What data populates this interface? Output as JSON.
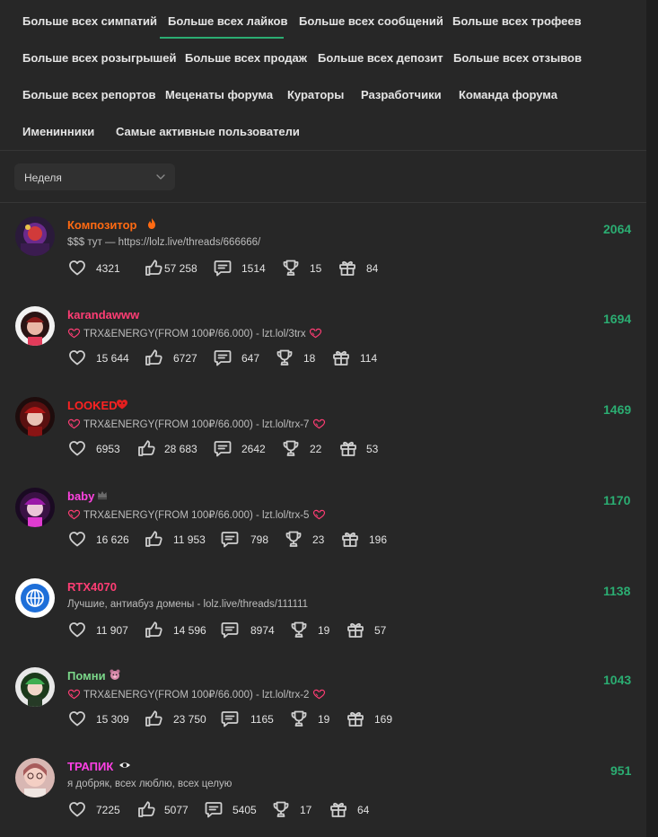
{
  "tabs": [
    "Больше всех симпатий",
    "Больше всех лайков",
    "Больше всех сообщений",
    "Больше всех трофеев",
    "Больше всех розыгрышей",
    "Больше всех продаж",
    "Больше всех депозит",
    "Больше всех отзывов",
    "Больше всех репортов",
    "Меценаты форума",
    "Кураторы",
    "Разработчики",
    "Команда форума",
    "Именинники",
    "Самые активные пользователи"
  ],
  "active_tab": "Больше всех лайков",
  "period": {
    "selected": "Неделя"
  },
  "users": [
    {
      "name": "Композитор",
      "name_color": "#ff6a12",
      "status": "$$$ тут — https://lolz.live/threads/666666/",
      "score": "2064",
      "likes": "4321",
      "thumbs": "57 258",
      "messages": "1514",
      "trophies": "15",
      "gifts": "84",
      "badge": "fire-icon"
    },
    {
      "name": "karandawww",
      "name_color": "#ff3d74",
      "status": "TRX&ENERGY(FROM 100₽/66.000) - lzt.lol/3trx",
      "score": "1694",
      "likes": "15 644",
      "thumbs": "6727",
      "messages": "647",
      "trophies": "18",
      "gifts": "114"
    },
    {
      "name": "LOOKED",
      "name_color": "#ff2222",
      "status": "TRX&ENERGY(FROM 100₽/66.000) - lzt.lol/trx-7",
      "score": "1469",
      "likes": "6953",
      "thumbs": "28 683",
      "messages": "2642",
      "trophies": "22",
      "gifts": "53",
      "badge": "heart-face-icon"
    },
    {
      "name": "baby",
      "name_color": "#ff43e0",
      "status": "TRX&ENERGY(FROM 100₽/66.000) - lzt.lol/trx-5",
      "score": "1170",
      "likes": "16 626",
      "thumbs": "11 953",
      "messages": "798",
      "trophies": "23",
      "gifts": "196",
      "badge": "crown-icon"
    },
    {
      "name": "RTX4070",
      "name_color": "#ff3d74",
      "status": "Лучшие, антиабуз домены - lolz.live/threads/111111",
      "score": "1138",
      "likes": "11 907",
      "thumbs": "14 596",
      "messages": "8974",
      "trophies": "19",
      "gifts": "57"
    },
    {
      "name": "Помни",
      "name_color": "#7bd88a",
      "status": "TRX&ENERGY(FROM 100₽/66.000) - lzt.lol/trx-2",
      "score": "1043",
      "likes": "15 309",
      "thumbs": "23 750",
      "messages": "1165",
      "trophies": "19",
      "gifts": "169",
      "badge": "bear-icon"
    },
    {
      "name": "ТРАПИК",
      "name_color": "#ff40e6",
      "status": "я добряк, всех люблю, всех целую",
      "score": "951",
      "likes": "7225",
      "thumbs": "5077",
      "messages": "5405",
      "trophies": "17",
      "gifts": "64",
      "badge": "eye-icon"
    }
  ],
  "colors": {
    "accent": "#2bad72",
    "heart": "#ff3d74"
  }
}
